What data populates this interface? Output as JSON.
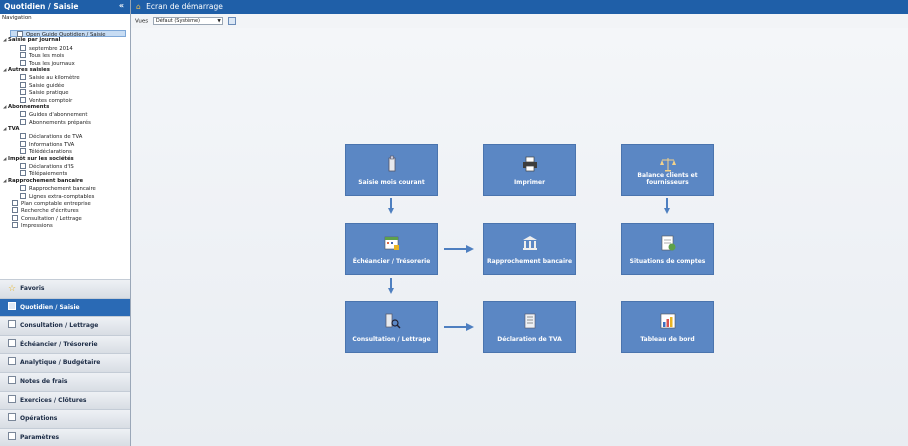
{
  "sidebar": {
    "title": "Quotidien / Saisie",
    "collapse_glyph": "«",
    "navigation_label": "Navigation",
    "tree": [
      {
        "label": "Open Guide Quotidien / Saisie",
        "kind": "selected",
        "icon": "guide-icon"
      },
      {
        "label": "Saisie par journal",
        "kind": "group"
      },
      {
        "label": "septembre 2014",
        "kind": "item",
        "icon": "journal-icon"
      },
      {
        "label": "Tous les mois",
        "kind": "item",
        "icon": "journal-icon"
      },
      {
        "label": "Tous les journaux",
        "kind": "item",
        "icon": "journal-icon"
      },
      {
        "label": "Autres saisies",
        "kind": "group"
      },
      {
        "label": "Saisie au kilomètre",
        "kind": "item",
        "icon": "document-icon"
      },
      {
        "label": "Saisie guidée",
        "kind": "item",
        "icon": "document-icon"
      },
      {
        "label": "Saisie pratique",
        "kind": "item",
        "icon": "document-icon"
      },
      {
        "label": "Ventes comptoir",
        "kind": "item",
        "icon": "register-icon"
      },
      {
        "label": "Abonnements",
        "kind": "group"
      },
      {
        "label": "Guides d'abonnement",
        "kind": "item",
        "icon": "document-icon"
      },
      {
        "label": "Abonnements préparés",
        "kind": "item",
        "icon": "document-icon"
      },
      {
        "label": "TVA",
        "kind": "group"
      },
      {
        "label": "Déclarations de TVA",
        "kind": "item",
        "icon": "document-icon"
      },
      {
        "label": "Informations TVA",
        "kind": "item",
        "icon": "document-icon"
      },
      {
        "label": "Télédéclarations",
        "kind": "item",
        "icon": "document-icon"
      },
      {
        "label": "Impôt sur les sociétés",
        "kind": "group"
      },
      {
        "label": "Déclarations d'IS",
        "kind": "item",
        "icon": "document-icon"
      },
      {
        "label": "Télépaiements",
        "kind": "item",
        "icon": "document-icon"
      },
      {
        "label": "Rapprochement bancaire",
        "kind": "group"
      },
      {
        "label": "Rapprochement bancaire",
        "kind": "item",
        "icon": "bank-icon"
      },
      {
        "label": "Lignes extra-comptables",
        "kind": "item",
        "icon": "document-icon"
      },
      {
        "label": "Plan comptable entreprise",
        "kind": "item2",
        "icon": "book-icon"
      },
      {
        "label": "Recherche d'écritures",
        "kind": "item2",
        "icon": "search-icon"
      },
      {
        "label": "Consultation / Lettrage",
        "kind": "item2",
        "icon": "book-icon"
      },
      {
        "label": "Impressions",
        "kind": "item2",
        "icon": "printer-icon"
      }
    ],
    "accordion": [
      {
        "label": "Favoris",
        "icon": "star-icon",
        "active": false
      },
      {
        "label": "Quotidien / Saisie",
        "icon": "journal-icon",
        "active": true
      },
      {
        "label": "Consultation / Lettrage",
        "icon": "book-icon",
        "active": false
      },
      {
        "label": "Échéancier / Trésorerie",
        "icon": "calendar-icon",
        "active": false
      },
      {
        "label": "Analytique / Budgétaire",
        "icon": "chart-icon",
        "active": false
      },
      {
        "label": "Notes de frais",
        "icon": "receipt-icon",
        "active": false
      },
      {
        "label": "Exercices / Clôtures",
        "icon": "folder-icon",
        "active": false
      },
      {
        "label": "Opérations",
        "icon": "operations-icon",
        "active": false
      },
      {
        "label": "Paramètres",
        "icon": "settings-icon",
        "active": false
      }
    ]
  },
  "main": {
    "title": "Ecran de démarrage",
    "toolbar": {
      "views_label": "Vues",
      "views_value": "Défaut (Système)"
    },
    "tiles": {
      "saisie": "Saisie mois courant",
      "imprimer": "Imprimer",
      "balance": "Balance clients et fournisseurs",
      "echeancier": "Échéancier / Trésorerie",
      "rapprochement": "Rapprochement bancaire",
      "situations": "Situations de comptes",
      "consultation": "Consultation / Lettrage",
      "declaration": "Déclaration de TVA",
      "tableau": "Tableau de bord"
    }
  },
  "colors": {
    "header_blue": "#1f5fa8",
    "tile_blue": "#5b87c4",
    "arrow_blue": "#4e7fc0"
  }
}
